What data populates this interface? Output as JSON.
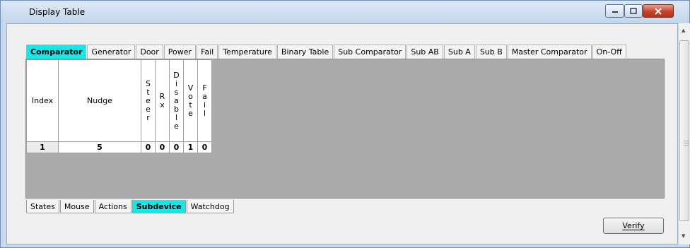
{
  "window": {
    "title": "Display Table"
  },
  "top_tabs": [
    "Comparator",
    "Generator",
    "Door",
    "Power",
    "Fail",
    "Temperature",
    "Binary Table",
    "Sub Comparator",
    "Sub AB",
    "Sub A",
    "Sub B",
    "Master Comparator",
    "On-Off"
  ],
  "top_tabs_selected": "Comparator",
  "grid": {
    "headers": {
      "index": "Index",
      "nudge": "Nudge",
      "steer": [
        "S",
        "t",
        "e",
        "e",
        "r"
      ],
      "rx": [
        "R",
        "x"
      ],
      "disable": [
        "D",
        "i",
        "s",
        "a",
        "b",
        "l",
        "e"
      ],
      "vote": [
        "V",
        "o",
        "t",
        "e"
      ],
      "fail": [
        "F",
        "a",
        "i",
        "l"
      ]
    },
    "rows": [
      {
        "index": "1",
        "nudge": "5",
        "steer": "0",
        "rx": "0",
        "disable": "0",
        "vote": "1",
        "fail": "0"
      }
    ]
  },
  "bottom_tabs": [
    "States",
    "Mouse",
    "Actions",
    "Subdevice",
    "Watchdog"
  ],
  "bottom_tabs_selected": "Subdevice",
  "verify_label": "Verify",
  "colors": {
    "selected_tab": "#19e6e6",
    "grid_background": "#ababab",
    "window_frame": "#c8d9ee"
  }
}
